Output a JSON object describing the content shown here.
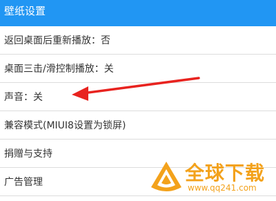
{
  "app_bar": {
    "title": "壁纸设置"
  },
  "settings": [
    {
      "label": "返回桌面后重新播放：否"
    },
    {
      "label": "桌面三击/滑控制播放：关"
    },
    {
      "label": "声音：关"
    },
    {
      "label": "兼容模式(MIUI8设置为锁屏)"
    },
    {
      "label": "捐赠与支持"
    },
    {
      "label": "广告管理"
    }
  ],
  "annotation": {
    "arrow_icon": "red-arrow-icon",
    "arrow_color": "#e8231f"
  },
  "watermark": {
    "brand": "全球下载",
    "site": "www.qq241.com",
    "color": "#f3a21c"
  },
  "colors": {
    "app_bar": "#2196f3",
    "divider": "#dcdcdc",
    "text": "#333333"
  }
}
